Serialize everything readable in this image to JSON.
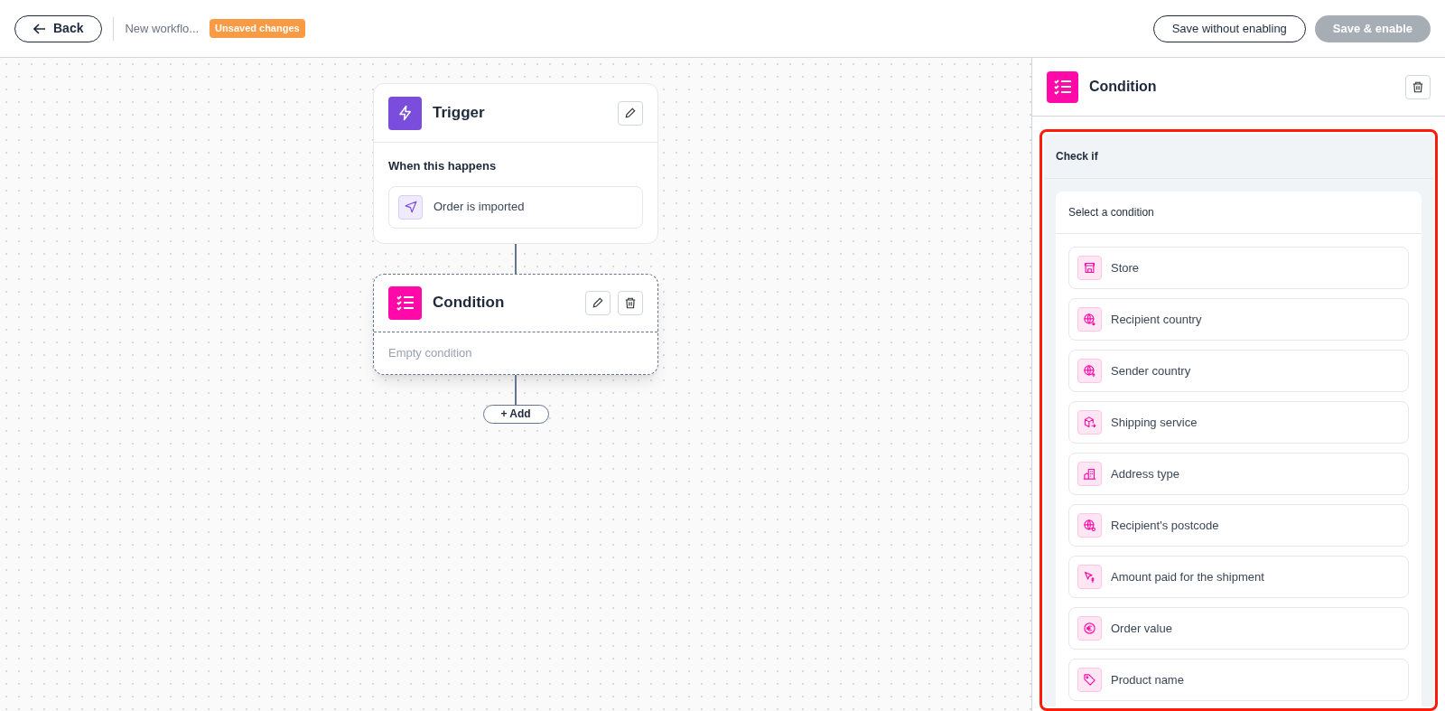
{
  "header": {
    "back": "Back",
    "title": "New workflo...",
    "badge": "Unsaved changes",
    "save_draft": "Save without enabling",
    "save_enable": "Save & enable",
    "save_enable_disabled": true
  },
  "canvas": {
    "trigger": {
      "title": "Trigger",
      "section": "When this happens",
      "event": "Order is imported"
    },
    "condition": {
      "title": "Condition",
      "placeholder": "Empty condition",
      "selected": true
    },
    "add": "+ Add"
  },
  "panel": {
    "title": "Condition",
    "section": "Check if",
    "subtitle": "Select a condition",
    "options": [
      {
        "label": "Store"
      },
      {
        "label": "Recipient country"
      },
      {
        "label": "Sender country"
      },
      {
        "label": "Shipping service"
      },
      {
        "label": "Address type"
      },
      {
        "label": "Recipient's postcode"
      },
      {
        "label": "Amount paid for the shipment"
      },
      {
        "label": "Order value"
      },
      {
        "label": "Product name"
      }
    ]
  }
}
